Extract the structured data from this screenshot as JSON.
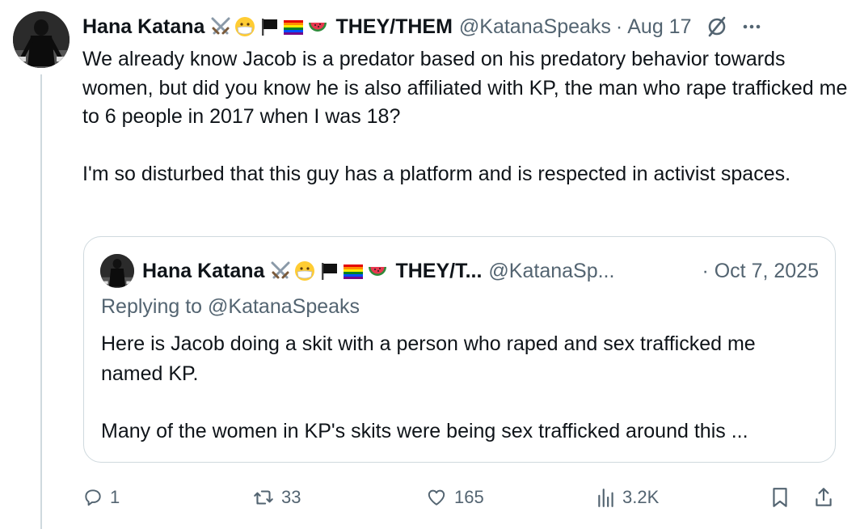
{
  "tweet": {
    "author_name": "Hana Katana",
    "emojis": [
      "crossed-swords",
      "medical-mask-face",
      "black-flag",
      "rainbow-flag",
      "watermelon"
    ],
    "name_suffix": "THEY/THEM",
    "handle": "@KatanaSpeaks",
    "separator": "·",
    "date": "Aug 17",
    "paragraphs": [
      "We already know Jacob is a predator based on his predatory behavior towards women, but did you know he is also affiliated with KP, the man who rape trafficked me to 6 people in 2017 when I was 18?",
      "I'm so disturbed that this guy has a platform and is respected in activist spaces."
    ]
  },
  "quoted": {
    "author_name": "Hana Katana",
    "name_suffix": "THEY/T...",
    "handle": "@KatanaSp...",
    "date": "· Oct 7, 2025",
    "replying_prefix": "Replying to ",
    "replying_handle": "@KatanaSpeaks",
    "paragraphs": [
      "Here is Jacob doing a skit with a person who raped and sex trafficked me named KP.",
      "Many of the women in KP's skits were being sex trafficked around this ..."
    ]
  },
  "actions": {
    "reply_count": "1",
    "repost_count": "33",
    "like_count": "165",
    "view_count": "3.2K"
  },
  "colors": {
    "text": "#0f1419",
    "muted": "#536471",
    "border": "#cfd9de"
  }
}
